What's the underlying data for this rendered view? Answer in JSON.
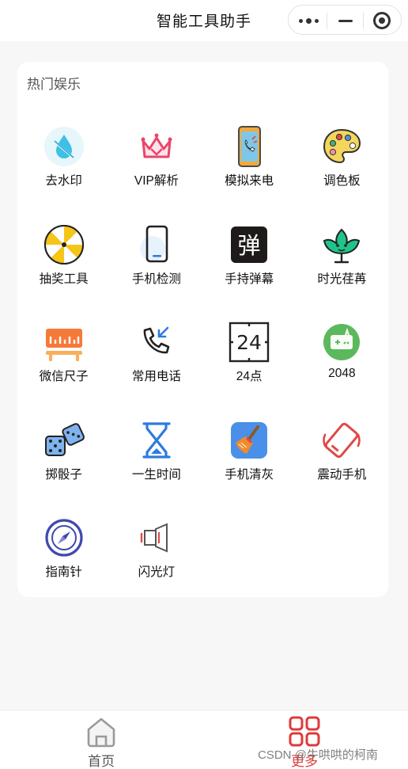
{
  "app": {
    "title": "智能工具助手",
    "capsule": {
      "more_icon": "more-dots-icon",
      "minimize_icon": "minimize-icon",
      "close_icon": "close-target-icon"
    }
  },
  "section": {
    "title": "热门娱乐",
    "tools": [
      {
        "label": "去水印",
        "icon": "water-drop-icon"
      },
      {
        "label": "VIP解析",
        "icon": "vip-crown-icon"
      },
      {
        "label": "模拟来电",
        "icon": "phone-call-icon"
      },
      {
        "label": "调色板",
        "icon": "palette-icon"
      },
      {
        "label": "抽奖工具",
        "icon": "lottery-wheel-icon"
      },
      {
        "label": "手机检测",
        "icon": "phone-check-icon"
      },
      {
        "label": "手持弹幕",
        "icon": "danmu-icon",
        "glyph": "弹"
      },
      {
        "label": "时光荏苒",
        "icon": "leaf-time-icon"
      },
      {
        "label": "微信尺子",
        "icon": "ruler-icon"
      },
      {
        "label": "常用电话",
        "icon": "phone-incoming-icon"
      },
      {
        "label": "24点",
        "icon": "card-24-icon",
        "glyph": "24"
      },
      {
        "label": "2048",
        "icon": "game-2048-icon"
      },
      {
        "label": "掷骰子",
        "icon": "dice-icon"
      },
      {
        "label": "一生时间",
        "icon": "hourglass-icon"
      },
      {
        "label": "手机清灰",
        "icon": "broom-icon"
      },
      {
        "label": "震动手机",
        "icon": "vibrate-phone-icon"
      },
      {
        "label": "指南针",
        "icon": "compass-icon"
      },
      {
        "label": "闪光灯",
        "icon": "flashlight-icon"
      }
    ]
  },
  "tabbar": {
    "home": {
      "label": "首页",
      "icon": "home-icon"
    },
    "more": {
      "label": "更多",
      "icon": "grid-icon"
    }
  },
  "watermark": "CSDN @牛哄哄的柯南",
  "colors": {
    "accent_red": "#e03a3a",
    "page_bg": "#f7f7f7"
  }
}
